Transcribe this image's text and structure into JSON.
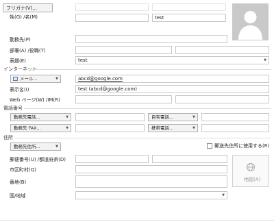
{
  "name": {
    "furigana_button": "フリガナ(V)...",
    "label": "姓(G) /名(M)",
    "first_value": "test"
  },
  "company": {
    "label": "勤務先(P)"
  },
  "department": {
    "label": "部署(A) /役職(T)"
  },
  "display_as": {
    "label": "表題(E)",
    "value": "test"
  },
  "internet": {
    "section": "インターネット",
    "email_button": "メール...",
    "email_value": "abcd@google.com",
    "display_name_label": "表示名(I)",
    "display_name_value": "test (abcd@google.com)",
    "webpage_label": "Web ページ(W) /IM(R)"
  },
  "phone": {
    "section": "電話番号",
    "business_button": "勤務先電話...",
    "home_button": "自宅電話...",
    "business_fax_button": "勤務先 FAX...",
    "mobile_button": "携帯電話..."
  },
  "address": {
    "section": "住所",
    "type_button": "勤務先住所...",
    "mailing_checkbox": "郵送先住所に使用する(R)",
    "mailing_checked": false,
    "postal_label": "郵便番号(U) /都道府県(D)",
    "city_label": "市区町村(Q)",
    "street_label": "番地(B)",
    "country_label": "国/地域",
    "map_button": "地図(A)"
  },
  "icons": [
    "contact-photo-icon",
    "email-icon",
    "phone-icon",
    "address-book-icon",
    "globe-map-icon",
    "dropdown-caret-icon"
  ]
}
